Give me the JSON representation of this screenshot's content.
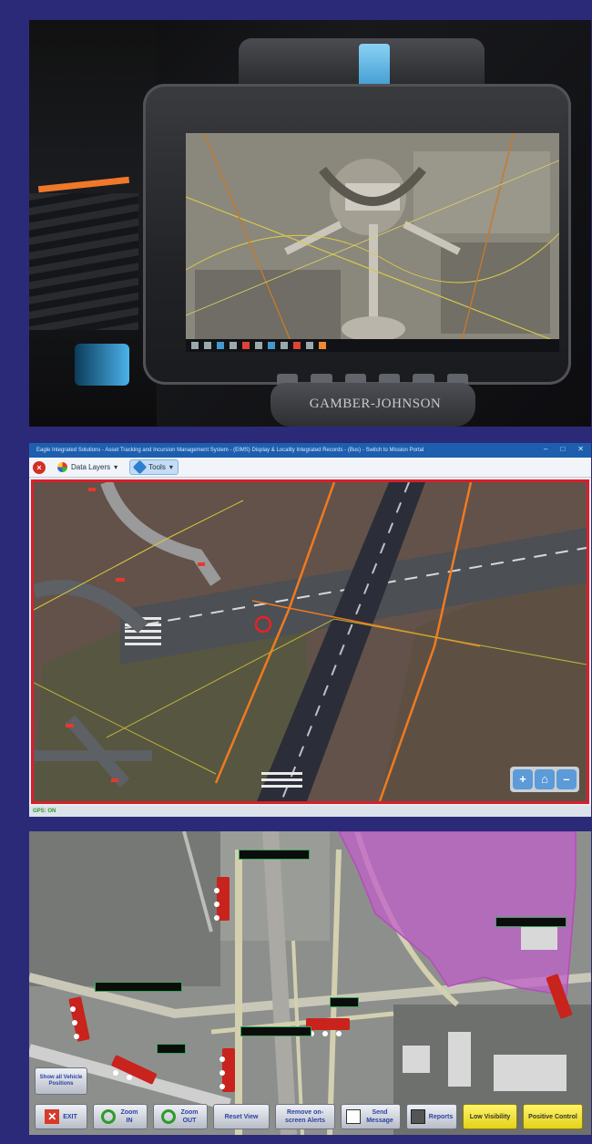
{
  "photo": {
    "brand": "GAMBER-JOHNSON",
    "hardware_buttons": [
      "",
      "",
      "",
      "",
      "",
      "",
      "",
      ""
    ]
  },
  "app": {
    "window_title": "Eagle Integrated Solutions - Asset Tracking and Incursion Management System - (EIMS) Display & Locality Integrated Records - (Bus) - Switch to Mission Portal",
    "toolbar": {
      "data_layers_label": "Data Layers",
      "tools_label": "Tools"
    },
    "status": "GPS: ON"
  },
  "tracking": {
    "vehicle_tags": [
      "",
      "",
      "",
      "",
      "",
      "",
      ""
    ],
    "buttons": {
      "show_all": "Show all Vehicle Positions",
      "exit": "EXIT",
      "zoom_in": "Zoom IN",
      "zoom_out": "Zoom OUT",
      "reset_view": "Reset View",
      "remove_alerts": "Remove on-screen Alerts",
      "send_message": "Send Message",
      "reports": "Reports",
      "low_visibility": "Low Visibility",
      "positive_control": "Positive Control"
    }
  },
  "colors": {
    "frame": "#2b2a78",
    "window_title_bar": "#1d5fae",
    "map_border": "#d8202a",
    "restricted_zone": "#c060c8",
    "vehicle": "#c8231d",
    "tag_text": "#78f08c",
    "button_yellow": "#f3e43a"
  }
}
